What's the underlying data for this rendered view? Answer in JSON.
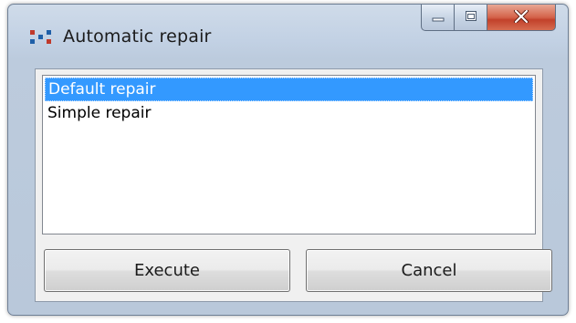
{
  "window": {
    "title": "Automatic repair",
    "app_icon": "dots-icon",
    "controls": [
      "minimize-icon",
      "maximize-icon",
      "close-icon"
    ],
    "close_color": "#c94a31"
  },
  "listbox": {
    "items": [
      {
        "label": "Default repair",
        "selected": true
      },
      {
        "label": "Simple repair",
        "selected": false
      }
    ],
    "selection_color": "#3399ff"
  },
  "buttons": {
    "execute_label": "Execute",
    "cancel_label": "Cancel"
  }
}
